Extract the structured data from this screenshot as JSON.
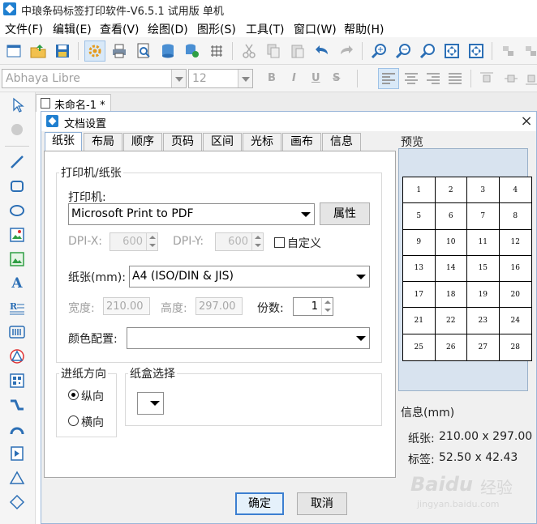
{
  "app": {
    "title": "中琅条码标签打印软件-V6.5.1 试用版 单机"
  },
  "menu": [
    {
      "label": "文件(F)"
    },
    {
      "label": "编辑(E)"
    },
    {
      "label": "查看(V)"
    },
    {
      "label": "绘图(D)"
    },
    {
      "label": "图形(S)"
    },
    {
      "label": "工具(T)"
    },
    {
      "label": "窗口(W)"
    },
    {
      "label": "帮助(H)"
    }
  ],
  "formatbar": {
    "font_name": "Abhaya Libre",
    "font_size": "12",
    "bold": "B",
    "italic": "I",
    "underline": "U",
    "strike": "S"
  },
  "document": {
    "tab_label": "未命名-1 *"
  },
  "dialog": {
    "title": "文档设置",
    "close": "×",
    "tabs": [
      {
        "label": "纸张",
        "active": true
      },
      {
        "label": "布局"
      },
      {
        "label": "顺序"
      },
      {
        "label": "页码"
      },
      {
        "label": "区间"
      },
      {
        "label": "光标"
      },
      {
        "label": "画布"
      },
      {
        "label": "信息"
      }
    ],
    "printer_group": {
      "title": "打印机/纸张",
      "printer_label": "打印机:",
      "printer_value": "Microsoft Print to PDF",
      "properties_button": "属性",
      "dpix_label": "DPI-X:",
      "dpix_value": "600",
      "dpiy_label": "DPI-Y:",
      "dpiy_value": "600",
      "custom_label": "自定义",
      "paper_label": "纸张(mm):",
      "paper_value": "A4 (ISO/DIN & JIS)",
      "width_label": "宽度:",
      "width_value": "210.00",
      "height_label": "高度:",
      "height_value": "297.00",
      "copies_label": "份数:",
      "copies_value": "1",
      "color_label": "颜色配置:",
      "color_value": ""
    },
    "feed_group": {
      "title": "进纸方向",
      "portrait": "纵向",
      "landscape": "横向",
      "selected": "纵向"
    },
    "tray_group": {
      "title": "纸盒选择"
    },
    "preview": {
      "title": "预览",
      "cells": [
        "1",
        "2",
        "3",
        "4",
        "5",
        "6",
        "7",
        "8",
        "9",
        "10",
        "11",
        "12",
        "13",
        "14",
        "15",
        "16",
        "17",
        "18",
        "19",
        "20",
        "21",
        "22",
        "23",
        "24",
        "25",
        "26",
        "27",
        "28"
      ]
    },
    "info": {
      "title": "信息(mm)",
      "paper_label": "纸张:",
      "paper_value": "210.00 x 297.00",
      "label_label": "标签:",
      "label_value": "52.50 x 42.43"
    },
    "ok_button": "确定",
    "cancel_button": "取消"
  },
  "watermark": {
    "brand": "Baidu",
    "text": "经验",
    "url": "jingyan.baidu.com"
  },
  "colors": {
    "accent": "#3c7fd1",
    "preview_bg": "#d8e3ef"
  }
}
